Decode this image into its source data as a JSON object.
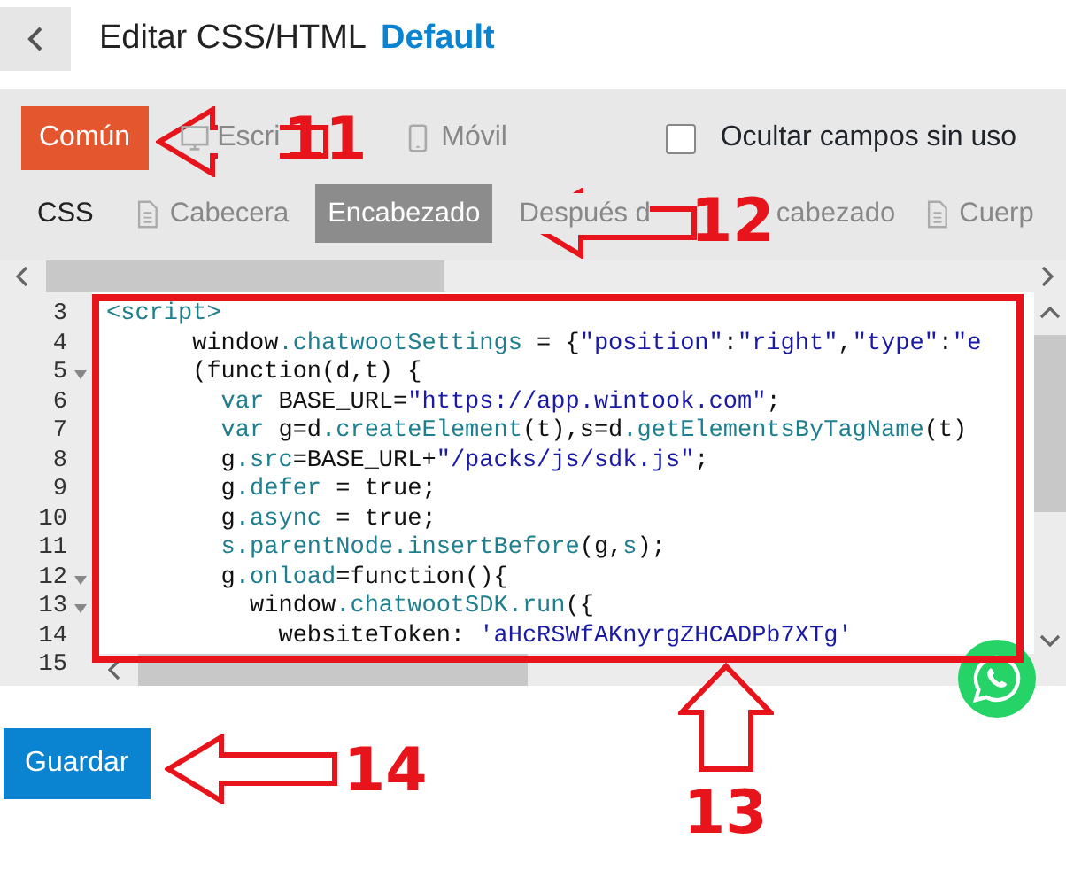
{
  "header": {
    "title": "Editar CSS/HTML",
    "theme": "Default"
  },
  "devices": [
    {
      "label": "Común",
      "kind": "plain",
      "selected": true,
      "disabled": false
    },
    {
      "label": "Escri",
      "kind": "desktop",
      "selected": false,
      "disabled": true
    },
    {
      "label": "Móvil",
      "kind": "mobile",
      "selected": false,
      "disabled": true
    }
  ],
  "hide_unused": {
    "label": "Ocultar campos sin uso",
    "checked": false
  },
  "sections": [
    {
      "label": "CSS",
      "kind": "plain",
      "selected": false,
      "disabled": false
    },
    {
      "label": "Cabecera",
      "kind": "file",
      "selected": false,
      "disabled": true
    },
    {
      "label": "Encabezado",
      "kind": "plain",
      "selected": true,
      "disabled": false
    },
    {
      "label": "Después d",
      "tail": "cabezado",
      "kind": "plain",
      "selected": false,
      "disabled": true
    },
    {
      "label": "Cuerp",
      "kind": "file",
      "selected": false,
      "disabled": true
    }
  ],
  "editor": {
    "lines": [
      {
        "number": "3",
        "fold": false,
        "tokens": [
          {
            "kind": "tag",
            "text": "<script>"
          }
        ]
      },
      {
        "number": "4",
        "fold": false,
        "tokens": [
          {
            "kind": "plain",
            "text": "      window"
          },
          {
            "kind": "prop",
            "text": ".chatwootSettings"
          },
          {
            "kind": "plain",
            "text": " = {"
          },
          {
            "kind": "string",
            "text": "\"position\""
          },
          {
            "kind": "plain",
            "text": ":"
          },
          {
            "kind": "string",
            "text": "\"right\""
          },
          {
            "kind": "plain",
            "text": ","
          },
          {
            "kind": "string",
            "text": "\"type\""
          },
          {
            "kind": "plain",
            "text": ":"
          },
          {
            "kind": "string",
            "text": "\"e"
          }
        ]
      },
      {
        "number": "5",
        "fold": true,
        "tokens": [
          {
            "kind": "plain",
            "text": "      (function(d,t) {"
          }
        ]
      },
      {
        "number": "6",
        "fold": false,
        "tokens": [
          {
            "kind": "keyword",
            "text": "        var"
          },
          {
            "kind": "plain",
            "text": " BASE_URL="
          },
          {
            "kind": "string",
            "text": "\"https://app.wintook.com\""
          },
          {
            "kind": "plain",
            "text": ";"
          }
        ]
      },
      {
        "number": "7",
        "fold": false,
        "tokens": [
          {
            "kind": "keyword",
            "text": "        var"
          },
          {
            "kind": "plain",
            "text": " g=d"
          },
          {
            "kind": "prop",
            "text": ".createElement"
          },
          {
            "kind": "plain",
            "text": "(t),s=d"
          },
          {
            "kind": "prop",
            "text": ".getElementsByTagName"
          },
          {
            "kind": "plain",
            "text": "(t)"
          }
        ]
      },
      {
        "number": "8",
        "fold": false,
        "tokens": [
          {
            "kind": "plain",
            "text": "        g"
          },
          {
            "kind": "prop",
            "text": ".src"
          },
          {
            "kind": "plain",
            "text": "=BASE_URL+"
          },
          {
            "kind": "string",
            "text": "\"/packs/js/sdk.js\""
          },
          {
            "kind": "plain",
            "text": ";"
          }
        ]
      },
      {
        "number": "9",
        "fold": false,
        "tokens": [
          {
            "kind": "plain",
            "text": "        g"
          },
          {
            "kind": "prop",
            "text": ".defer"
          },
          {
            "kind": "plain",
            "text": " = true;"
          }
        ]
      },
      {
        "number": "10",
        "fold": false,
        "tokens": [
          {
            "kind": "plain",
            "text": "        g"
          },
          {
            "kind": "prop",
            "text": ".async"
          },
          {
            "kind": "plain",
            "text": " = true;"
          }
        ]
      },
      {
        "number": "11",
        "fold": false,
        "tokens": [
          {
            "kind": "prop",
            "text": "        s.parentNode.insertBefore"
          },
          {
            "kind": "plain",
            "text": "(g,"
          },
          {
            "kind": "prop",
            "text": "s"
          },
          {
            "kind": "plain",
            "text": ");"
          }
        ]
      },
      {
        "number": "12",
        "fold": true,
        "tokens": [
          {
            "kind": "plain",
            "text": "        g"
          },
          {
            "kind": "prop",
            "text": ".onload"
          },
          {
            "kind": "plain",
            "text": "=function(){"
          }
        ]
      },
      {
        "number": "13",
        "fold": true,
        "tokens": [
          {
            "kind": "plain",
            "text": "          window"
          },
          {
            "kind": "prop",
            "text": ".chatwootSDK.run"
          },
          {
            "kind": "plain",
            "text": "({"
          }
        ]
      },
      {
        "number": "14",
        "fold": false,
        "tokens": [
          {
            "kind": "plain",
            "text": "            websiteToken: "
          },
          {
            "kind": "string",
            "text": "'aHcRSWfAKnyrgZHCADPb7XTg'"
          }
        ]
      },
      {
        "number": "15",
        "fold": false
      }
    ]
  },
  "save_button": "Guardar",
  "annotations": [
    {
      "number": "11",
      "kind": "left"
    },
    {
      "number": "12",
      "kind": "left"
    },
    {
      "number": "13",
      "kind": "up"
    },
    {
      "number": "14",
      "kind": "left"
    }
  ]
}
